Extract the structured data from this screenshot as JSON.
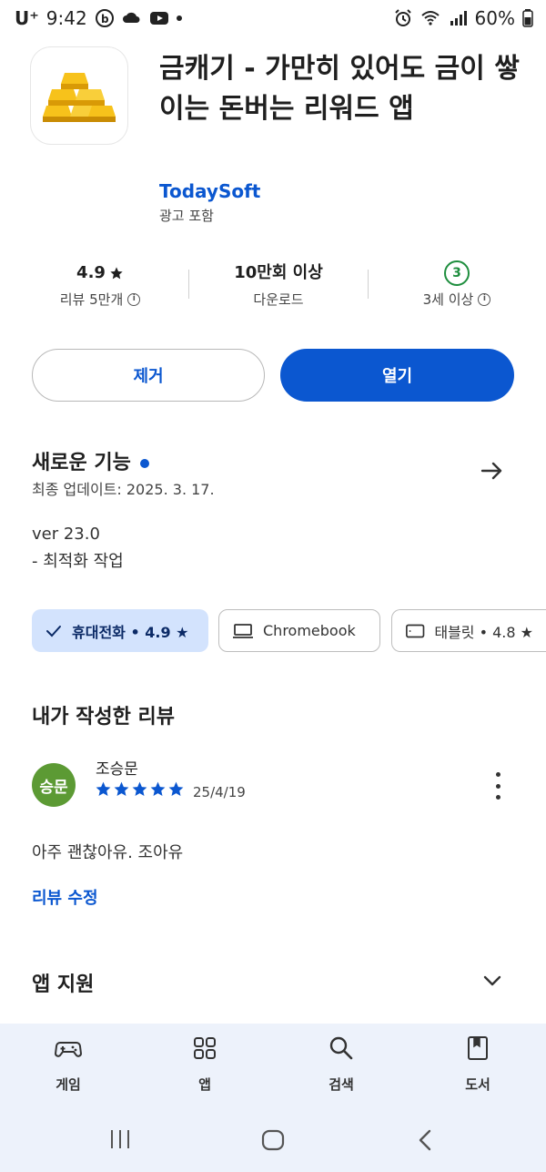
{
  "status_bar": {
    "carrier": "U⁺",
    "time": "9:42",
    "battery": "60%"
  },
  "app": {
    "title": "금캐기 - 가만히 있어도 금이 쌓이는 돈버는 리워드 앱",
    "developer": "TodaySoft",
    "ad_label": "광고 포함",
    "icon": "gold-bars-icon"
  },
  "stats": {
    "rating_value": "4.9",
    "rating_label": "리뷰 5만개",
    "downloads_value": "10만회 이상",
    "downloads_label": "다운로드",
    "age_badge": "3",
    "age_label": "3세 이상"
  },
  "buttons": {
    "remove": "제거",
    "open": "열기"
  },
  "whats_new": {
    "title": "새로운 기능",
    "last_updated": "최종 업데이트: 2025. 3. 17.",
    "version": "ver 23.0",
    "notes": "- 최적화 작업"
  },
  "device_chips": [
    {
      "label": "휴대전화 • 4.9 ★",
      "selected": true,
      "icon": "check-icon"
    },
    {
      "label": "Chromebook",
      "selected": false,
      "icon": "laptop-icon"
    },
    {
      "label": "태블릿 • 4.8 ★",
      "selected": false,
      "icon": "tablet-icon"
    }
  ],
  "my_review": {
    "section_title": "내가 작성한 리뷰",
    "avatar_text": "승문",
    "reviewer": "조승문",
    "stars": 5,
    "date": "25/4/19",
    "text": "아주 괜찮아유. 조아유",
    "edit_label": "리뷰 수정"
  },
  "app_support": {
    "title": "앱 지원"
  },
  "bottom_nav": [
    {
      "label": "게임",
      "icon": "gamepad-icon"
    },
    {
      "label": "앱",
      "icon": "apps-grid-icon"
    },
    {
      "label": "검색",
      "icon": "search-icon"
    },
    {
      "label": "도서",
      "icon": "book-icon"
    }
  ],
  "colors": {
    "accent": "#0b57d0",
    "chip_selected_bg": "#d3e3fd",
    "age_green": "#1e8e3e",
    "avatar_green": "#5c9a34",
    "nav_bg": "#edf2fb"
  }
}
